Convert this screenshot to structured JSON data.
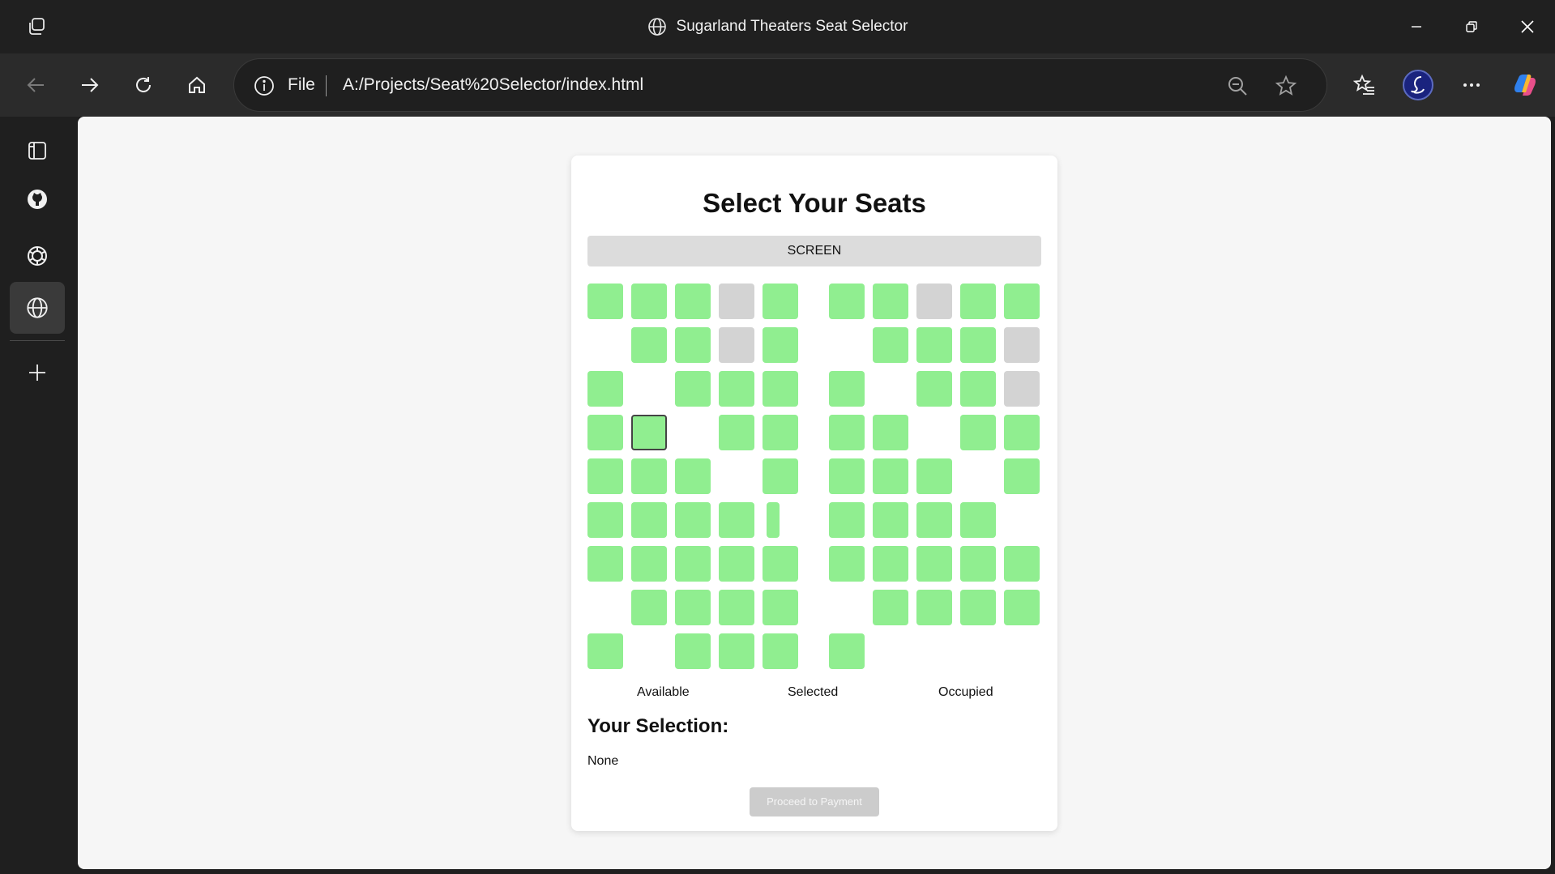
{
  "window": {
    "title": "Sugarland Theaters Seat Selector",
    "controls": [
      "minimize-icon",
      "restore-icon",
      "close-icon"
    ]
  },
  "toolbar": {
    "scheme": "File",
    "url": "A:/Projects/Seat%20Selector/index.html",
    "icons": [
      "back-icon",
      "forward-icon",
      "refresh-icon",
      "home-icon",
      "info-icon",
      "zoom-out-icon",
      "star-icon",
      "favorites-icon",
      "profile-avatar",
      "more-icon",
      "copilot-icon"
    ]
  },
  "sidebar": {
    "items": [
      "tabs-icon",
      "github-icon",
      "chatgpt-icon",
      "globe-icon",
      "add-icon"
    ]
  },
  "page": {
    "heading": "Select Your Seats",
    "screen_label": "SCREEN",
    "seat_rows": [
      "AAAOA-AAOAA",
      ".AAOA|.AAAO",
      "A.AAA|A.AAO",
      "AS.AA|AA.AA",
      "AAA.A|AAA.A",
      "AAAA.|AAAA.",
      "AAAAA-AAAAA",
      ".AAAA|.AAAA",
      "A.AAA|A...."
    ],
    "legend": {
      "available": "Available",
      "selected": "Selected",
      "occupied": "Occupied"
    },
    "selection_title": "Your Selection:",
    "selection_value": "None",
    "proceed_label": "Proceed to Payment"
  },
  "colors": {
    "available": "#90ee90",
    "occupied": "#d3d3d3",
    "button_disabled": "#cccccc"
  }
}
